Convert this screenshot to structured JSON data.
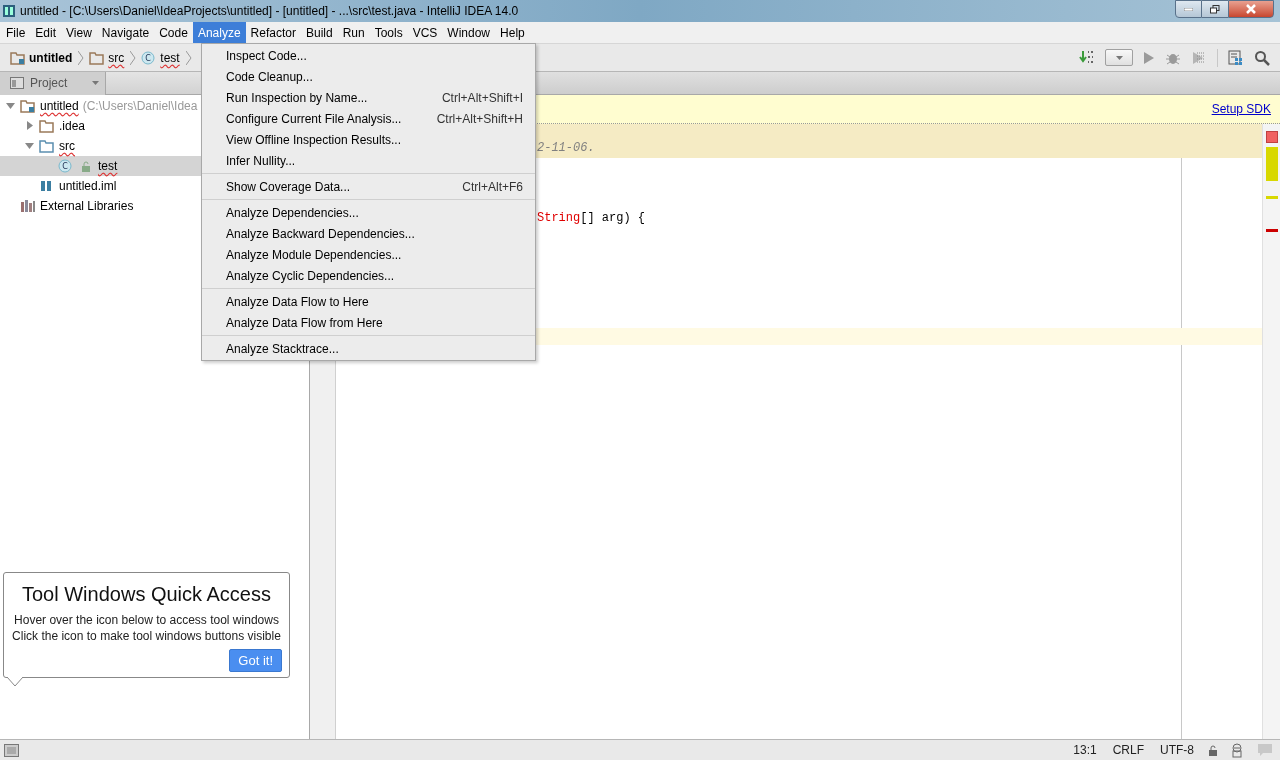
{
  "window": {
    "title": "untitled - [C:\\Users\\Daniel\\IdeaProjects\\untitled] - [untitled] - ...\\src\\test.java - IntelliJ IDEA 14.0"
  },
  "menu_bar": [
    {
      "label": "File",
      "selected": false
    },
    {
      "label": "Edit",
      "selected": false
    },
    {
      "label": "View",
      "selected": false
    },
    {
      "label": "Navigate",
      "selected": false
    },
    {
      "label": "Code",
      "selected": false
    },
    {
      "label": "Analyze",
      "selected": true
    },
    {
      "label": "Refactor",
      "selected": false
    },
    {
      "label": "Build",
      "selected": false
    },
    {
      "label": "Run",
      "selected": false
    },
    {
      "label": "Tools",
      "selected": false
    },
    {
      "label": "VCS",
      "selected": false
    },
    {
      "label": "Window",
      "selected": false
    },
    {
      "label": "Help",
      "selected": false
    }
  ],
  "breadcrumbs": [
    {
      "label": "untitled",
      "kind": "project"
    },
    {
      "label": "src",
      "kind": "folder"
    },
    {
      "label": "test",
      "kind": "class",
      "badge": "C"
    }
  ],
  "project_panel": {
    "view": "Project",
    "tree": [
      {
        "label": "untitled",
        "hint": "(C:\\Users\\Daniel\\Idea",
        "kind": "project",
        "expanded": true,
        "selected": false,
        "children": [
          {
            "label": ".idea",
            "kind": "folder",
            "expanded": false,
            "selected": false
          },
          {
            "label": "src",
            "kind": "source",
            "expanded": true,
            "selected": false,
            "children": [
              {
                "label": "test",
                "kind": "class",
                "badge": "C",
                "selected": true
              }
            ]
          },
          {
            "label": "untitled.iml",
            "kind": "module",
            "selected": false
          }
        ]
      },
      {
        "label": "External Libraries",
        "kind": "library",
        "selected": false
      }
    ]
  },
  "notification": {
    "link": "Setup SDK"
  },
  "editor": {
    "lines": [
      {
        "kind": "comment",
        "highlighted": true,
        "segments": [
          {
            "kind": "comment",
            "text": "2-11-06."
          }
        ]
      },
      {
        "kind": "blank"
      },
      {
        "kind": "blank"
      },
      {
        "kind": "blank"
      },
      {
        "kind": "code",
        "highlighted": false,
        "segments": [
          {
            "kind": "error",
            "text": "String"
          },
          {
            "kind": "plain",
            "text": "[] arg) {"
          }
        ]
      },
      {
        "kind": "blank"
      },
      {
        "kind": "blank"
      },
      {
        "kind": "blank"
      },
      {
        "kind": "blank"
      },
      {
        "kind": "blank"
      },
      {
        "kind": "blank"
      },
      {
        "kind": "caret",
        "highlighted": true
      }
    ]
  },
  "analyze_menu": {
    "groups": [
      [
        {
          "label": "Inspect Code..."
        },
        {
          "label": "Code Cleanup..."
        },
        {
          "label": "Run Inspection by Name...",
          "shortcut": "Ctrl+Alt+Shift+I"
        },
        {
          "label": "Configure Current File Analysis...",
          "shortcut": "Ctrl+Alt+Shift+H"
        },
        {
          "label": "View Offline Inspection Results..."
        },
        {
          "label": "Infer Nullity..."
        }
      ],
      [
        {
          "label": "Show Coverage Data...",
          "shortcut": "Ctrl+Alt+F6"
        }
      ],
      [
        {
          "label": "Analyze Dependencies..."
        },
        {
          "label": "Analyze Backward Dependencies..."
        },
        {
          "label": "Analyze Module Dependencies..."
        },
        {
          "label": "Analyze Cyclic Dependencies..."
        }
      ],
      [
        {
          "label": "Analyze Data Flow to Here"
        },
        {
          "label": "Analyze Data Flow from Here"
        }
      ],
      [
        {
          "label": "Analyze Stacktrace..."
        }
      ]
    ]
  },
  "tooltip": {
    "title": "Tool Windows Quick Access",
    "lines": [
      "Hover over the icon below to access tool windows",
      "Click the icon to make tool windows buttons visible"
    ],
    "button": "Got it!"
  },
  "status_bar": {
    "position": "13:1",
    "line_separator": "CRLF",
    "encoding": "UTF-8"
  }
}
